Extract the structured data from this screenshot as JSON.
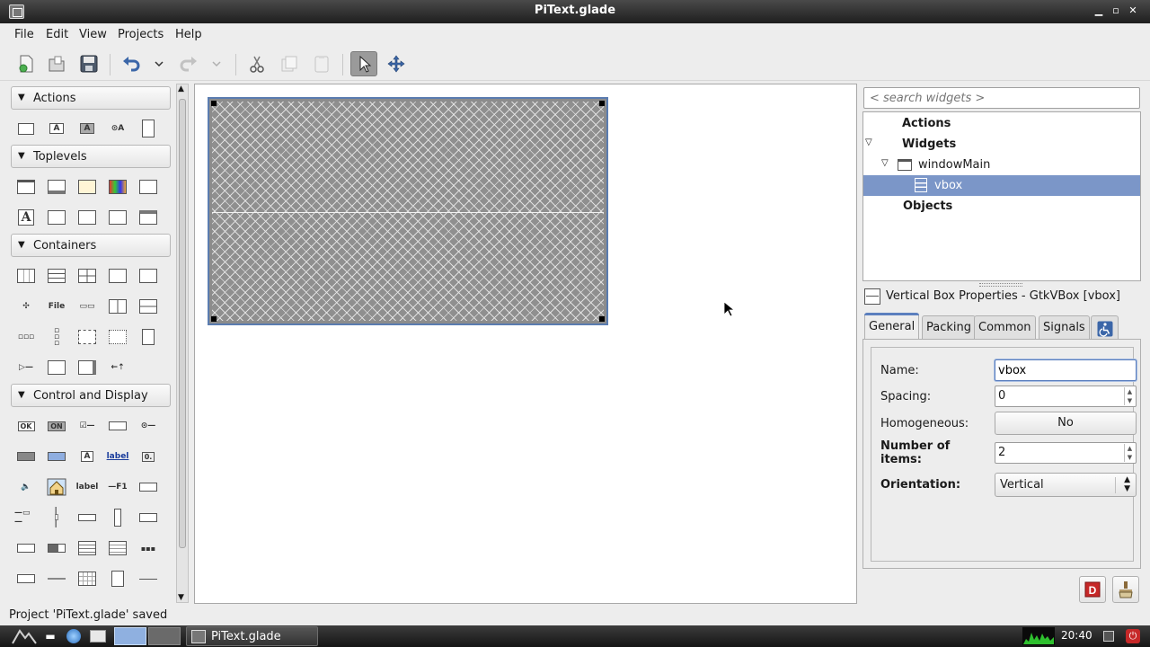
{
  "window": {
    "title": "PiText.glade"
  },
  "menubar": {
    "items": [
      "File",
      "Edit",
      "View",
      "Projects",
      "Help"
    ]
  },
  "palette": {
    "groups": [
      {
        "label": "Actions"
      },
      {
        "label": "Toplevels"
      },
      {
        "label": "Containers"
      },
      {
        "label": "Control and Display"
      }
    ],
    "glyphs": {
      "file": "File",
      "ok": "OK",
      "on": "ON",
      "label_blue": "label",
      "label": "label",
      "f1": "—F1",
      "digit": "0.",
      "a": "A"
    }
  },
  "search": {
    "placeholder": "< search widgets >"
  },
  "inspector": {
    "rows": [
      {
        "label": "Actions"
      },
      {
        "label": "Widgets"
      },
      {
        "label": "windowMain"
      },
      {
        "label": "vbox"
      },
      {
        "label": "Objects"
      }
    ]
  },
  "properties": {
    "header": "Vertical Box Properties - GtkVBox [vbox]",
    "tabs": [
      "General",
      "Packing",
      "Common",
      "Signals"
    ],
    "active_tab": "General",
    "fields": {
      "name_label": "Name:",
      "name_value": "vbox",
      "spacing_label": "Spacing:",
      "spacing_value": "0",
      "homogeneous_label": "Homogeneous:",
      "homogeneous_value": "No",
      "items_label_line1": "Number of",
      "items_label_line2": "items:",
      "items_value": "2",
      "orientation_label": "Orientation:",
      "orientation_value": "Vertical"
    }
  },
  "status": {
    "text": "Project 'PiText.glade' saved"
  },
  "taskbar": {
    "task_label": "PiText.glade",
    "clock": "20:40"
  },
  "colors": {
    "accent": "#5b7fbe",
    "selection": "#7b96c8",
    "titlebar": "#2a2a2a"
  }
}
